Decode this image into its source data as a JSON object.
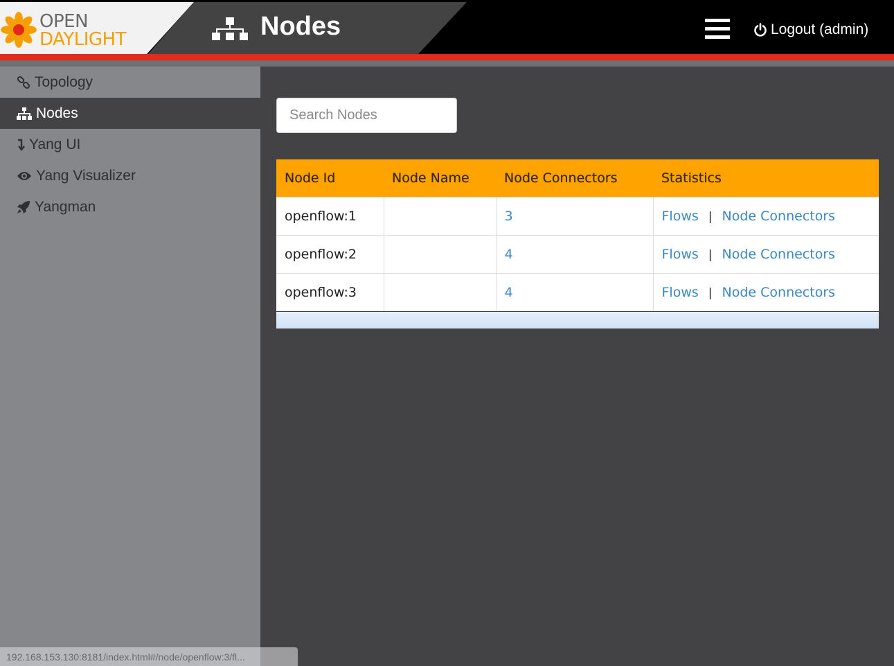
{
  "header": {
    "logo_line1": "OPEN",
    "logo_line2": "DAYLIGHT",
    "page_title": "Nodes",
    "logout_label": "Logout (admin)"
  },
  "sidebar": {
    "items": [
      {
        "label": "Topology",
        "icon": "link-icon"
      },
      {
        "label": "Nodes",
        "icon": "sitemap-icon",
        "active": true
      },
      {
        "label": "Yang UI",
        "icon": "arrow-down-icon"
      },
      {
        "label": "Yang Visualizer",
        "icon": "eye-icon"
      },
      {
        "label": "Yangman",
        "icon": "rocket-icon"
      }
    ]
  },
  "search": {
    "placeholder": "Search Nodes",
    "value": ""
  },
  "table": {
    "columns": [
      "Node Id",
      "Node Name",
      "Node Connectors",
      "Statistics"
    ],
    "rows": [
      {
        "node_id": "openflow:1",
        "node_name": "",
        "connectors": "3",
        "flows": "Flows",
        "sep": "|",
        "node_connectors": "Node Connectors"
      },
      {
        "node_id": "openflow:2",
        "node_name": "",
        "connectors": "4",
        "flows": "Flows",
        "sep": "|",
        "node_connectors": "Node Connectors"
      },
      {
        "node_id": "openflow:3",
        "node_name": "",
        "connectors": "4",
        "flows": "Flows",
        "sep": "|",
        "node_connectors": "Node Connectors"
      }
    ]
  },
  "status_url": "192.168.153.130:8181/index.html#/node/openflow:3/fl...",
  "colors": {
    "accent": "#ffa300",
    "header_red": "#e3291b",
    "link": "#3a86c6"
  }
}
